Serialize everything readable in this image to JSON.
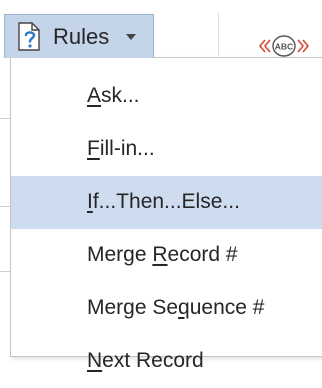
{
  "ribbon": {
    "rules_button": {
      "label": "Rules",
      "icon": "document-question-icon",
      "caret_icon": "caret-down-icon"
    },
    "merge_field_icon": "insert-merge-field-icon"
  },
  "menu": {
    "items": [
      {
        "pre": "",
        "accel": "A",
        "post": "sk...",
        "highlighted": false
      },
      {
        "pre": "",
        "accel": "F",
        "post": "ill-in...",
        "highlighted": false
      },
      {
        "pre": "",
        "accel": "I",
        "post": "f...Then...Else...",
        "highlighted": true
      },
      {
        "pre": "Merge ",
        "accel": "R",
        "post": "ecord #",
        "highlighted": false
      },
      {
        "pre": "Merge Se",
        "accel": "q",
        "post": "uence #",
        "highlighted": false
      },
      {
        "pre": "",
        "accel": "N",
        "post": "ext Record",
        "highlighted": false
      }
    ]
  },
  "colors": {
    "pressed_button_bg": "#c5d5e9",
    "highlight_bg": "#cddcef",
    "menu_border": "#c6c6c6",
    "icon_blue": "#2b78c5"
  }
}
